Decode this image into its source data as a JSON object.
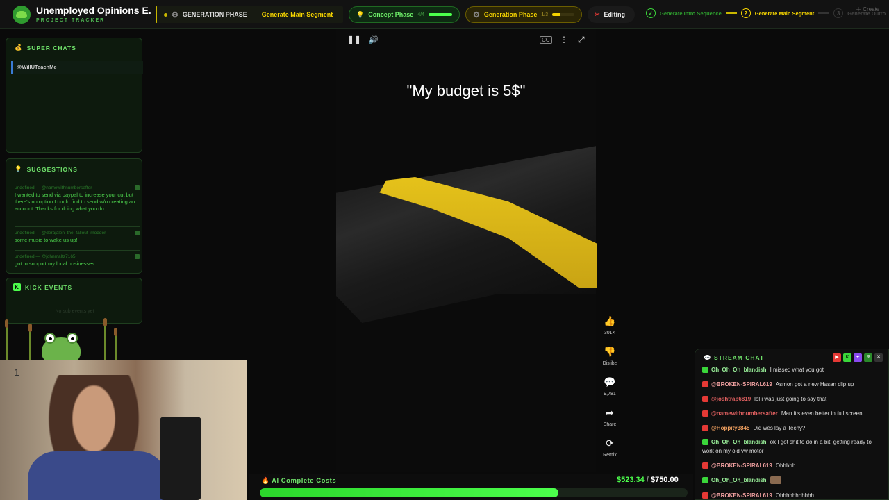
{
  "header": {
    "title": "Unemployed Opinions E...",
    "subtitle": "PROJECT TRACKER",
    "phase_label": "GENERATION PHASE",
    "phase_separator": "—",
    "phase_action": "Generate Main Segment",
    "concept_phase": {
      "label": "Concept Phase",
      "count": "4/4",
      "progress": 1.0
    },
    "generation_phase": {
      "label": "Generation Phase",
      "count": "1/3",
      "progress": 0.33
    },
    "editing": {
      "label": "Editing"
    },
    "steps": [
      {
        "label": "Generate Intro Sequence",
        "state": "done"
      },
      {
        "label": "Generate Main Segment",
        "state": "active",
        "number": "2"
      },
      {
        "label": "Generate Outro",
        "state": "pending",
        "number": "3"
      }
    ],
    "create_label": "Create"
  },
  "superchats": {
    "title": "SUPER CHATS",
    "items": [
      "@WillUTeachMe"
    ]
  },
  "suggestions": {
    "title": "SUGGESTIONS",
    "items": [
      {
        "who": "undefined — @namewithnumbersafter",
        "text": "I wanted to send via paypal to increase your cut but there's no option I could find to send w/o creating an account. Thanks for doing what you do."
      },
      {
        "who": "undefined — @derajalen_the_fallout_modder",
        "text": "some music to wake us up!"
      },
      {
        "who": "undefined — @johnmaltz7165",
        "text": "got to support my local businesses"
      }
    ]
  },
  "kick_events": {
    "title": "KICK EVENTS",
    "badge": "K",
    "empty": "No sub events yet"
  },
  "webcam": {
    "number": "1"
  },
  "video": {
    "caption": "\"My budget is 5$\"",
    "cc": "CC",
    "actions": [
      {
        "icon": "thumbs-up-icon",
        "label": "301K"
      },
      {
        "icon": "thumbs-down-icon",
        "label": "Dislike"
      },
      {
        "icon": "comment-icon",
        "label": "9,781"
      },
      {
        "icon": "share-icon",
        "label": "Share"
      },
      {
        "icon": "remix-icon",
        "label": "Remix"
      }
    ]
  },
  "chat": {
    "title": "STREAM CHAT",
    "messages": [
      {
        "platform": "kick",
        "user": "Oh_Oh_Oh_blandish",
        "text": "I missed what you got"
      },
      {
        "platform": "youtube",
        "user": "@BROKEN-SPIRAL619",
        "text": "Asmon got a new Hasan clip up"
      },
      {
        "platform": "youtube",
        "user": "@joshtrap6819",
        "text": "lol i was just going to say that"
      },
      {
        "platform": "youtube",
        "user": "@namewithnumbersafter",
        "text": "Man it's even better in full screen"
      },
      {
        "platform": "youtube",
        "user": "@Hoppity3845",
        "text": "Did wes lay a Techy?"
      },
      {
        "platform": "kick",
        "user": "Oh_Oh_Oh_blandish",
        "text": "ok I got shit to do in a bit, getting ready to work on my old vw motor"
      },
      {
        "platform": "youtube",
        "user": "@BROKEN-SPIRAL619",
        "text": "Ohhhhh"
      },
      {
        "platform": "kick",
        "user": "Oh_Oh_Oh_blandish",
        "text": ""
      },
      {
        "platform": "youtube",
        "user": "@BROKEN-SPIRAL619",
        "text": "Ohhhhhhhhhhh"
      }
    ]
  },
  "costs": {
    "label": "AI Complete Costs",
    "current": "$523.34",
    "separator": "/",
    "max": "$750.00",
    "progress": 0.698
  },
  "colors": {
    "accent": "#4cff4c",
    "phase_yellow": "#f5d400",
    "youtube": "#e53935",
    "kick": "#53fc18",
    "video_stripe": "#e5c21a"
  }
}
